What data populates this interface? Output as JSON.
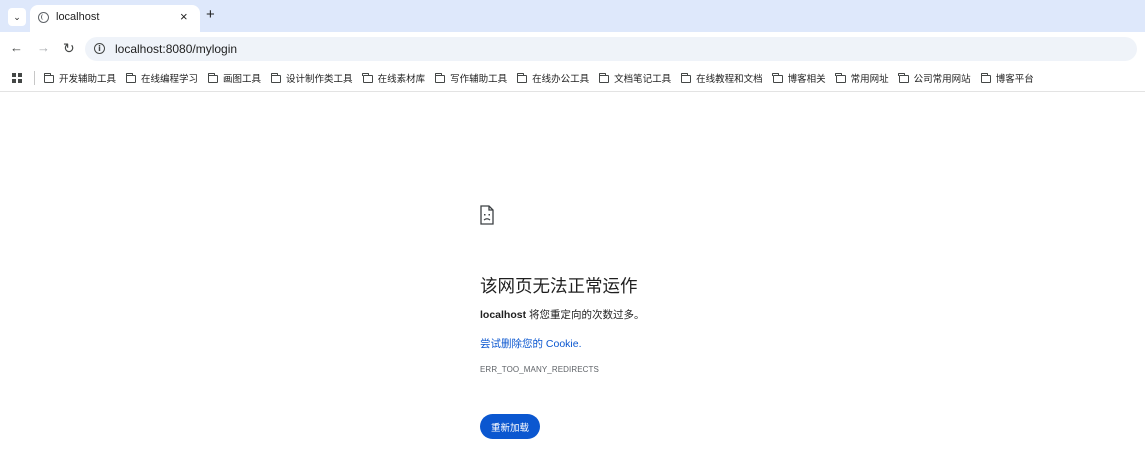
{
  "browser": {
    "tab": {
      "title": "localhost",
      "close_glyph": "×"
    },
    "new_tab_glyph": "+",
    "tab_menu_glyph": "⌄",
    "nav": {
      "back_glyph": "←",
      "forward_glyph": "→",
      "reload_glyph": "↻"
    },
    "omnibox": {
      "url": "localhost:8080/mylogin",
      "info_glyph": "i"
    },
    "bookmarks": [
      {
        "label": "开发辅助工具"
      },
      {
        "label": "在线编程学习"
      },
      {
        "label": "画图工具"
      },
      {
        "label": "设计制作类工具"
      },
      {
        "label": "在线素材库"
      },
      {
        "label": "写作辅助工具"
      },
      {
        "label": "在线办公工具"
      },
      {
        "label": "文档笔记工具"
      },
      {
        "label": "在线教程和文档"
      },
      {
        "label": "博客相关"
      },
      {
        "label": "常用网址"
      },
      {
        "label": "公司常用网站"
      },
      {
        "label": "博客平台"
      }
    ]
  },
  "error_page": {
    "title": "该网页无法正常运作",
    "host": "localhost",
    "description": " 将您重定向的次数过多。",
    "link_text": "尝试删除您的 Cookie",
    "link_suffix": ".",
    "error_code": "ERR_TOO_MANY_REDIRECTS",
    "reload_label": "重新加载"
  },
  "colors": {
    "tabstrip": "#dee8fb",
    "accent": "#0b57d0",
    "omnibox": "#eff3f9"
  },
  "icons": [
    "tab-menu-icon",
    "globe-icon",
    "close-icon",
    "plus-icon",
    "back-icon",
    "forward-icon",
    "reload-icon",
    "info-icon",
    "apps-icon",
    "folder-icon",
    "sad-document-icon"
  ]
}
